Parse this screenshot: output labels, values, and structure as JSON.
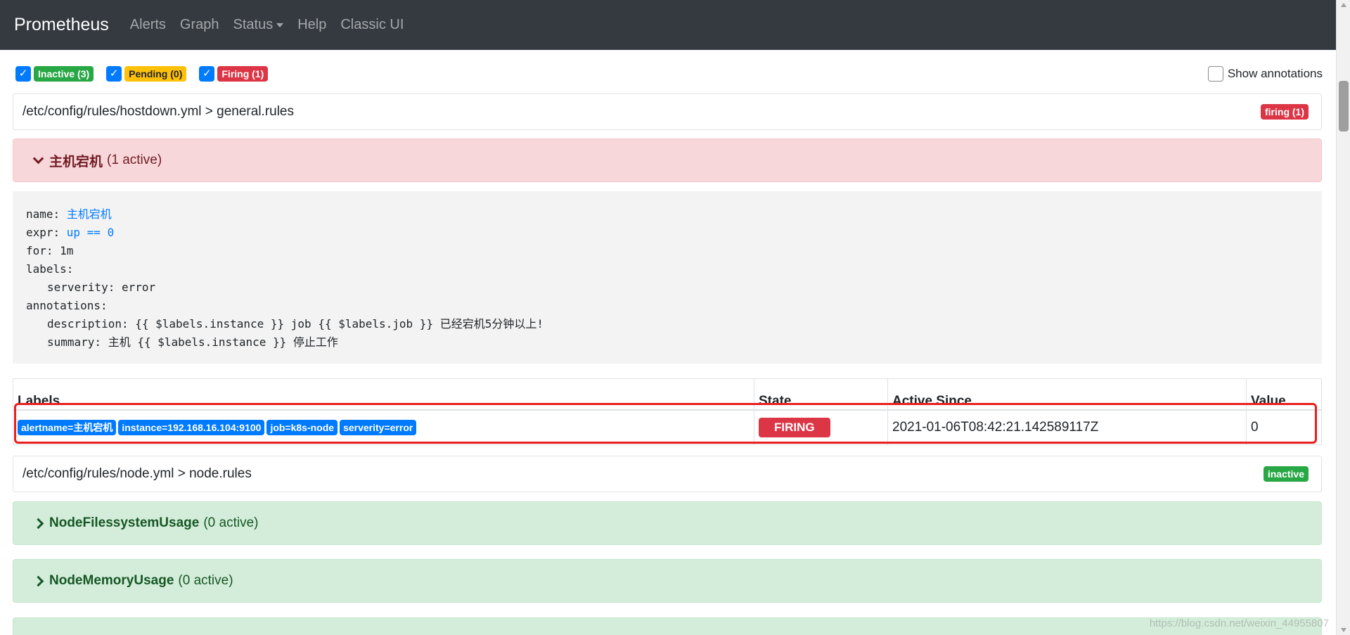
{
  "navbar": {
    "brand": "Prometheus",
    "items": [
      "Alerts",
      "Graph",
      "Status",
      "Help",
      "Classic UI"
    ]
  },
  "filters": [
    {
      "label": "Inactive (3)",
      "checked": true,
      "color": "#28a745"
    },
    {
      "label": "Pending (0)",
      "checked": true,
      "color": "#ffc107"
    },
    {
      "label": "Firing (1)",
      "checked": true,
      "color": "#dc3545"
    }
  ],
  "show_annotations": {
    "label": "Show annotations",
    "checked": false
  },
  "groups": [
    {
      "path": "/etc/config/rules/hostdown.yml > general.rules",
      "badge": "firing (1)",
      "badge_color": "#dc3545",
      "rules": [
        {
          "name": "主机宕机",
          "active": "(1 active)",
          "expanded": true,
          "definition": {
            "name_key": "name: ",
            "name_value": "主机宕机",
            "expr_key": "expr: ",
            "expr_value": "up == 0",
            "for_line": "for: 1m",
            "labels_key": "labels:",
            "labels_line": "serverity: error",
            "annotations_key": "annotations:",
            "description_line": "description: {{ $labels.instance }} job {{ $labels.job }} 已经宕机5分钟以上!",
            "summary_line": "summary: 主机 {{ $labels.instance }} 停止工作"
          },
          "table": {
            "headers": [
              "Labels",
              "State",
              "Active Since",
              "Value"
            ],
            "rows": [
              {
                "labels": [
                  "alertname=主机宕机",
                  "instance=192.168.16.104:9100",
                  "job=k8s-node",
                  "serverity=error"
                ],
                "state": "FIRING",
                "active_since": "2021-01-06T08:42:21.142589117Z",
                "value": "0"
              }
            ]
          }
        }
      ]
    },
    {
      "path": "/etc/config/rules/node.yml > node.rules",
      "badge": "inactive",
      "badge_color": "#28a745",
      "rules": [
        {
          "name": "NodeFilessystemUsage",
          "active": "(0 active)",
          "expanded": false
        },
        {
          "name": "NodeMemoryUsage",
          "active": "(0 active)",
          "expanded": false
        }
      ]
    }
  ],
  "watermark": "https://blog.csdn.net/weixin_44955807"
}
